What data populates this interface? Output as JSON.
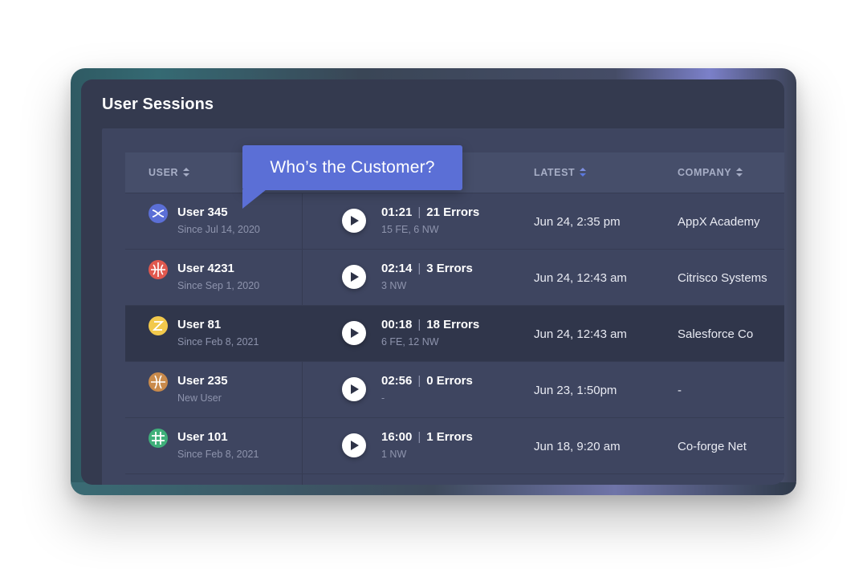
{
  "panel": {
    "title": "User Sessions"
  },
  "tooltip": {
    "text": "Who’s the Customer?"
  },
  "columns": {
    "user": "USER",
    "latest": "LATEST",
    "company": "COMPANY"
  },
  "colors": {
    "accent": "#5b6fd6",
    "sort_active": "#5b79e0",
    "sort_inactive": "#a7aec6"
  },
  "rows": [
    {
      "user": "User 345",
      "since": "Since Jul 14, 2020",
      "duration": "01:21",
      "errors": "21 Errors",
      "detail": "15 FE, 6 NW",
      "latest": "Jun  24, 2:35 pm",
      "company": "AppX Academy",
      "avatar_color": "#5b6fd6",
      "avatar_icon": "crossing-lines-icon"
    },
    {
      "user": "User 4231",
      "since": "Since Sep 1, 2020",
      "duration": "02:14",
      "errors": "3 Errors",
      "detail": "3 NW",
      "latest": "Jun  24, 12:43 am",
      "company": "Citrisco Systems",
      "avatar_color": "#e0584e",
      "avatar_icon": "globe-icon"
    },
    {
      "user": "User 81",
      "since": "Since Feb 8, 2021",
      "duration": "00:18",
      "errors": "18 Errors",
      "detail": "6 FE, 12 NW",
      "latest": "Jun  24, 12:43 am",
      "company": "Salesforce Co",
      "avatar_color": "#f2c94c",
      "avatar_icon": "z-icon"
    },
    {
      "user": "User 235",
      "since": "New User",
      "duration": "02:56",
      "errors": "0 Errors",
      "detail": "-",
      "latest": "Jun  23, 1:50pm",
      "company": "-",
      "avatar_color": "#c98a4b",
      "avatar_icon": "ball-icon"
    },
    {
      "user": "User 101",
      "since": "Since Feb 8, 2021",
      "duration": "16:00",
      "errors": "1 Errors",
      "detail": "1 NW",
      "latest": "Jun 18, 9:20 am",
      "company": "Co-forge Net",
      "avatar_color": "#3fb07a",
      "avatar_icon": "grid-icon"
    }
  ]
}
